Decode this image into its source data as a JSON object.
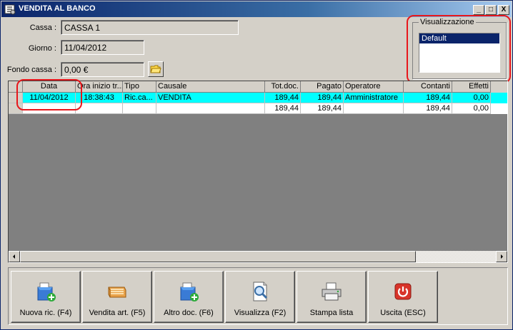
{
  "window": {
    "title": "VENDITA AL BANCO",
    "controls": {
      "minimize": "_",
      "maximize": "□",
      "close": "X"
    }
  },
  "form": {
    "cassa_label": "Cassa :",
    "cassa_value": "CASSA 1",
    "giorno_label": "Giorno :",
    "giorno_value": "11/04/2012",
    "fondo_label": "Fondo cassa :",
    "fondo_value": "0,00 €",
    "folder_icon": "folder-icon"
  },
  "visualizzazione": {
    "legend": "Visualizzazione",
    "items": [
      "Default"
    ]
  },
  "grid": {
    "columns": [
      "",
      "Data",
      "Ora inizio tr...",
      "Tipo",
      "Causale",
      "Tot.doc.",
      "Pagato",
      "Operatore",
      "Contanti",
      "Effetti"
    ],
    "rows": [
      [
        "",
        "11/04/2012",
        "18:38:43",
        "Ric.ca...",
        "VENDITA",
        "189,44",
        "189,44",
        "Amministratore",
        "189,44",
        "0,00"
      ]
    ],
    "totals": [
      "",
      "",
      "",
      "",
      "",
      "189,44",
      "189,44",
      "",
      "189,44",
      "0,00"
    ],
    "selected_color": "#00ffff"
  },
  "actions": [
    {
      "label": "Nuova ric. (F4)",
      "icon": "new-receipt-icon"
    },
    {
      "label": "Vendita art. (F5)",
      "icon": "sale-items-icon"
    },
    {
      "label": "Altro doc. (F6)",
      "icon": "other-document-icon"
    },
    {
      "label": "Visualizza (F2)",
      "icon": "view-document-icon"
    },
    {
      "label": "Stampa lista",
      "icon": "printer-icon"
    },
    {
      "label": "Uscita (ESC)",
      "icon": "exit-icon"
    }
  ],
  "colors": {
    "title_bar": "#0a246a",
    "selection": "#0a246a",
    "annotation": "#e8161b"
  }
}
